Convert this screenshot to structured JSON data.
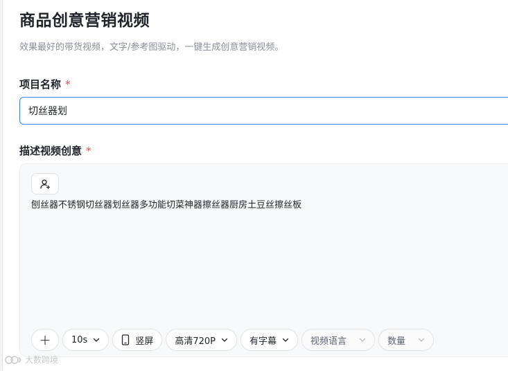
{
  "header": {
    "title": "商品创意营销视频",
    "subtitle": "效果最好的带货视频，文字/参考图驱动，一键生成创意营销视频。"
  },
  "form": {
    "project_name": {
      "label": "项目名称",
      "required_mark": "*",
      "value": "切丝器划"
    },
    "description": {
      "label": "描述视频创意",
      "required_mark": "*",
      "text": "刨丝器不锈钢切丝器划丝器多功能切菜神器擦丝器厨房土豆丝擦丝板"
    }
  },
  "toolbar": {
    "add_label": "+",
    "duration": "10s",
    "orientation": "竖屏",
    "quality": "高清720P",
    "subtitles": "有字幕",
    "language": "视频语言",
    "quantity": "数量"
  },
  "watermark": {
    "text": "大数跨境"
  },
  "colors": {
    "accent": "#3c7cf0",
    "required": "#e5484d"
  }
}
